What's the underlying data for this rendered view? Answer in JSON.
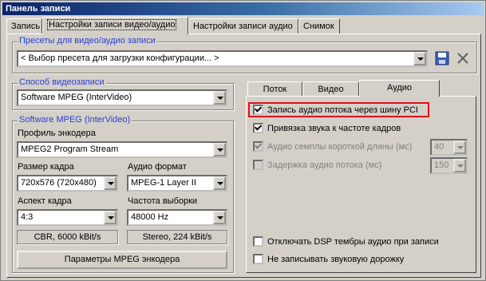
{
  "window": {
    "title": "Панель записи"
  },
  "tabs": [
    {
      "label": "Запись"
    },
    {
      "label": "Настройки записи видео/аудио"
    },
    {
      "label": "Настройки записи аудио"
    },
    {
      "label": "Снимок"
    }
  ],
  "presets": {
    "legend": "Пресеты для видео/аудио записи",
    "value": "< Выбор пресета для загрузки конфигурации... >"
  },
  "capture_method": {
    "legend": "Способ видеозаписи",
    "value": "Software MPEG (InterVideo)"
  },
  "software_mpeg": {
    "legend": "Software MPEG (InterVideo)",
    "profile_label": "Профиль энкодера",
    "profile_value": "MPEG2 Program Stream",
    "frame_size_label": "Размер кадра",
    "frame_size_value": "720x576 (720x480)",
    "audio_format_label": "Аудио формат",
    "audio_format_value": "MPEG-1 Layer II",
    "aspect_label": "Аспект кадра",
    "aspect_value": "4:3",
    "sample_rate_label": "Частота выборки",
    "sample_rate_value": "48000 Hz",
    "video_bitrate": "CBR, 6000 kBit/s",
    "audio_bitrate": "Stereo, 224 kBit/s",
    "params_button": "Параметры MPEG энкодера"
  },
  "subtabs": [
    {
      "label": "Поток"
    },
    {
      "label": "Видео"
    },
    {
      "label": "Аудио"
    }
  ],
  "audio_options": {
    "pci": {
      "label": "Запись аудио потока через шину PCI",
      "checked": true
    },
    "bind": {
      "label": "Привязка звука к частоте кадров",
      "checked": true
    },
    "short_samples": {
      "label": "Аудио семплы короткой длины (мс)",
      "checked": true,
      "value": "40"
    },
    "delay": {
      "label": "Задержка аудио потока (мс)",
      "checked": false,
      "value": "150"
    },
    "dsp": {
      "label": "Отключать DSP тембры аудио при записи",
      "checked": false
    },
    "no_audio": {
      "label": "Не записывать звуковую дорожку",
      "checked": false
    }
  },
  "colors": {
    "highlight": "#e0101a",
    "legend": "#2a3fd0",
    "title_bar": "#0a246a"
  },
  "icons": {
    "save": "floppy-disk-icon",
    "delete": "close-x-icon"
  }
}
